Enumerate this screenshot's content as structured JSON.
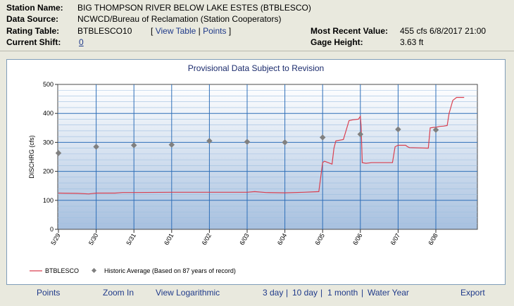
{
  "station": {
    "name_label": "Station Name:",
    "name": "BIG THOMPSON RIVER BELOW LAKE ESTES (BTBLESCO)",
    "source_label": "Data Source:",
    "source": "NCWCD/Bureau of Reclamation (Station Cooperators)",
    "rating_label": "Rating Table:",
    "rating": "BTBLESCO10",
    "rating_open": "[",
    "view_table": "View Table",
    "rating_sep": "|",
    "points": "Points",
    "rating_close": "]",
    "shift_label": "Current Shift:",
    "shift": "0",
    "recent_label": "Most Recent Value:",
    "recent": "455 cfs 6/8/2017 21:00",
    "gage_label": "Gage Height:",
    "gage": "3.63 ft"
  },
  "panel_title": "Provisional Data Subject to Revision",
  "bottom": {
    "points": "Points",
    "zoom": "Zoom In",
    "log": "View Logarithmic",
    "d3": "3 day",
    "d10": "10 day",
    "m1": "1 month",
    "wy": "Water Year",
    "export": "Export",
    "sep": "|"
  },
  "colors": {
    "discharge_line": "#d94050",
    "historic_marker": "#808080",
    "grid_major": "#2f6fb8",
    "grid_minor": "#9fbfe0",
    "plot_top": "#ffffff",
    "plot_bottom": "#a7c0df"
  },
  "chart_data": {
    "type": "line",
    "ylabel": "DISCHRG (cfs)",
    "ylim": [
      0,
      500
    ],
    "yticks": [
      0,
      100,
      200,
      300,
      400,
      500
    ],
    "xlim": [
      0,
      10.85
    ],
    "xticks": [
      "5/29",
      "5/30",
      "5/31",
      "6/01",
      "6/02",
      "6/03",
      "6/04",
      "6/05",
      "6/06",
      "6/07",
      "6/08"
    ],
    "grid": true,
    "legend_position": "bottom-left",
    "series": [
      {
        "name": "BTBLESCO",
        "style": "line",
        "x": [
          0,
          0.5,
          0.8,
          1.0,
          1.5,
          1.7,
          2.0,
          3.0,
          4.0,
          5.0,
          5.2,
          5.5,
          6.0,
          6.5,
          6.9,
          7.0,
          7.05,
          7.25,
          7.3,
          7.35,
          7.55,
          7.7,
          7.8,
          7.95,
          8.0,
          8.02,
          8.05,
          8.15,
          8.3,
          8.5,
          8.85,
          8.92,
          9.0,
          9.2,
          9.25,
          9.3,
          9.8,
          9.85,
          9.95,
          10.0,
          10.1,
          10.2,
          10.3,
          10.35,
          10.45,
          10.55,
          10.75
        ],
        "y": [
          125,
          124,
          122,
          125,
          125,
          127,
          127,
          128,
          128,
          128,
          130,
          127,
          126,
          128,
          130,
          230,
          235,
          225,
          280,
          305,
          310,
          375,
          378,
          380,
          390,
          355,
          230,
          228,
          230,
          230,
          230,
          285,
          290,
          290,
          285,
          282,
          280,
          350,
          352,
          352,
          355,
          356,
          358,
          400,
          445,
          455,
          455
        ]
      },
      {
        "name": "Historic Average (Based on 87 years of record)",
        "style": "marker",
        "x": [
          0,
          1,
          2,
          3,
          4,
          5,
          6,
          7,
          8,
          9,
          10
        ],
        "y": [
          263,
          285,
          290,
          292,
          305,
          302,
          300,
          317,
          328,
          345,
          343
        ]
      }
    ]
  }
}
